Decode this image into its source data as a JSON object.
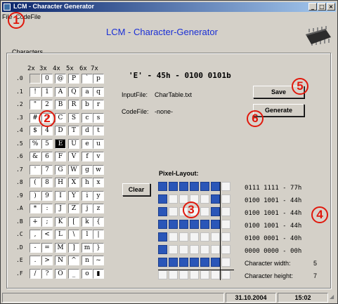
{
  "window": {
    "title": "LCM - Character Generator"
  },
  "window_buttons": {
    "minimize": "_",
    "maximize": "□",
    "close": "×"
  },
  "menu": {
    "items": [
      "File",
      "CodeFile"
    ]
  },
  "app_title": "LCM - Character-Generator",
  "characters": {
    "group_label": "Characters",
    "columns": [
      "2x",
      "3x",
      "4x",
      "5x",
      "6x",
      "7x"
    ],
    "rows": [
      {
        "label": ".0",
        "chars": [
          " ",
          "0",
          "@",
          "P",
          "`",
          "p"
        ]
      },
      {
        "label": ".1",
        "chars": [
          "!",
          "1",
          "A",
          "Q",
          "a",
          "q"
        ]
      },
      {
        "label": ".2",
        "chars": [
          "\"",
          "2",
          "B",
          "R",
          "b",
          "r"
        ]
      },
      {
        "label": ".3",
        "chars": [
          "#",
          "3",
          "C",
          "S",
          "c",
          "s"
        ]
      },
      {
        "label": ".4",
        "chars": [
          "$",
          "4",
          "D",
          "T",
          "d",
          "t"
        ]
      },
      {
        "label": ".5",
        "chars": [
          "%",
          "5",
          "E",
          "U",
          "e",
          "u"
        ]
      },
      {
        "label": ".6",
        "chars": [
          "&",
          "6",
          "F",
          "V",
          "f",
          "v"
        ]
      },
      {
        "label": ".7",
        "chars": [
          "'",
          "7",
          "G",
          "W",
          "g",
          "w"
        ]
      },
      {
        "label": ".8",
        "chars": [
          "(",
          "8",
          "H",
          "X",
          "h",
          "x"
        ]
      },
      {
        "label": ".9",
        "chars": [
          ")",
          "9",
          "I",
          "Y",
          "i",
          "y"
        ]
      },
      {
        "label": ".A",
        "chars": [
          "*",
          ":",
          "J",
          "Z",
          "j",
          "z"
        ]
      },
      {
        "label": ".B",
        "chars": [
          "+",
          ";",
          "K",
          "[",
          "k",
          "{"
        ]
      },
      {
        "label": ".C",
        "chars": [
          ",",
          "<",
          "L",
          "\\",
          "l",
          "|"
        ]
      },
      {
        "label": ".D",
        "chars": [
          "-",
          "=",
          "M",
          "]",
          "m",
          "}"
        ]
      },
      {
        "label": ".E",
        "chars": [
          ".",
          ">",
          "N",
          "^",
          "n",
          "~"
        ]
      },
      {
        "label": ".F",
        "chars": [
          "/",
          "?",
          "O",
          "_",
          "o",
          "▮"
        ]
      }
    ]
  },
  "selected_char": {
    "label": "'E' - 45h - 0100 0101b"
  },
  "info": {
    "input_label": "InputFile:",
    "input_value": "CharTable.txt",
    "code_label": "CodeFile:",
    "code_value": "-none-"
  },
  "buttons": {
    "save": "Save",
    "generate": "Generate",
    "clear": "Clear"
  },
  "pixel_layout": {
    "title": "Pixel-Layout:",
    "rows": [
      {
        "pixels": [
          1,
          1,
          1,
          1,
          1,
          1,
          0
        ],
        "code": "0111 1111 - 77h"
      },
      {
        "pixels": [
          1,
          0,
          0,
          0,
          0,
          1,
          0
        ],
        "code": "0100 1001 - 44h"
      },
      {
        "pixels": [
          1,
          0,
          0,
          0,
          0,
          1,
          0
        ],
        "code": "0100 1001 - 44h"
      },
      {
        "pixels": [
          1,
          1,
          1,
          1,
          1,
          1,
          0
        ],
        "code": "0100 1001 - 44h"
      },
      {
        "pixels": [
          1,
          0,
          0,
          0,
          0,
          0,
          0
        ],
        "code": "0100 0001 - 40h"
      },
      {
        "pixels": [
          1,
          0,
          0,
          0,
          0,
          0,
          0
        ],
        "code": "0000 0000 - 00h"
      },
      {
        "pixels": [
          1,
          1,
          1,
          1,
          1,
          1,
          0
        ],
        "code": ""
      },
      {
        "pixels": [
          0,
          0,
          0,
          0,
          0,
          0,
          0
        ],
        "code": ""
      }
    ]
  },
  "char_info": {
    "width_label": "Character width:",
    "width_value": "5",
    "height_label": "Character height:",
    "height_value": "7"
  },
  "status": {
    "date": "31.10.2004",
    "time": "15:02"
  },
  "markers": [
    "1",
    "2",
    "3",
    "4",
    "5",
    "6"
  ],
  "colors": {
    "accent": "#1a2fd6",
    "marker": "#e0180c",
    "pixel_on": "#2a56b8"
  }
}
